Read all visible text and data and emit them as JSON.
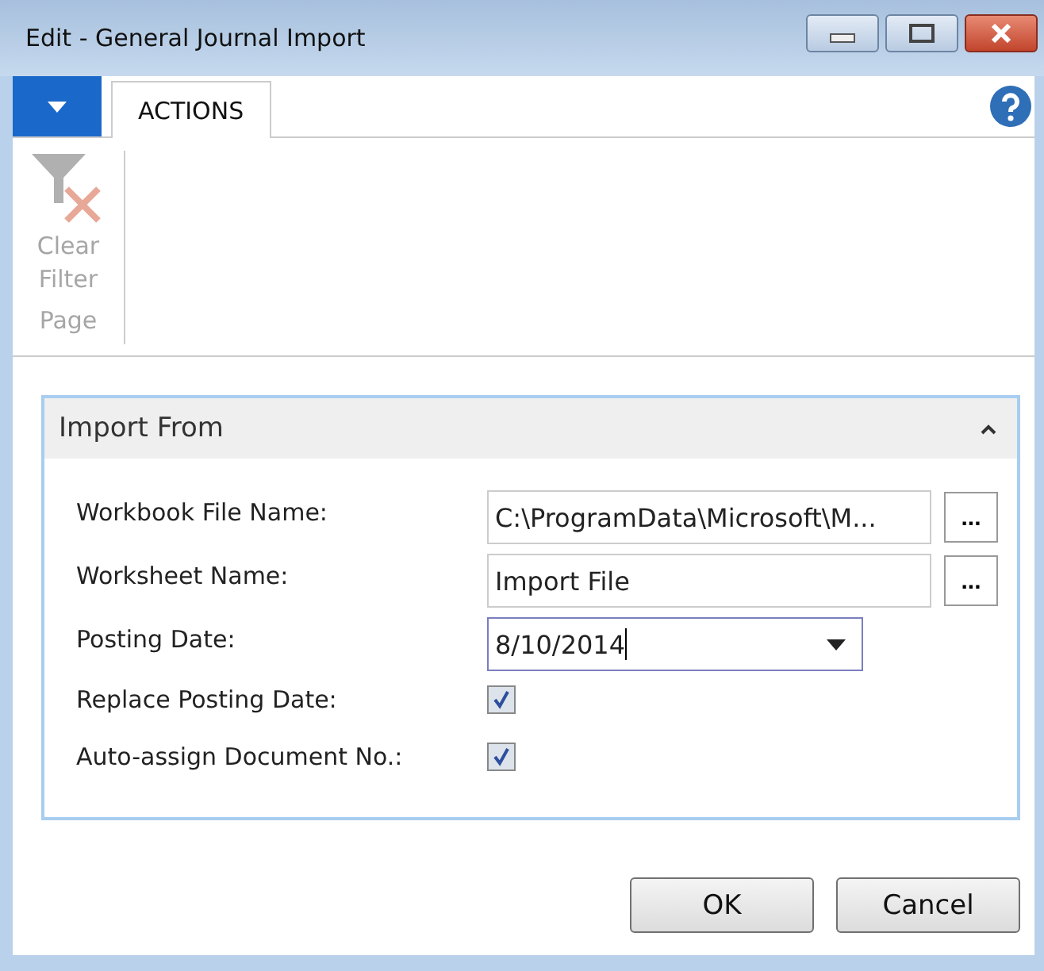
{
  "window": {
    "title": "Edit - General Journal Import"
  },
  "ribbon": {
    "tabs": [
      {
        "label": "ACTIONS",
        "selected": true
      }
    ],
    "actions": [
      {
        "label": "Clear Filter",
        "disabled": true
      }
    ],
    "group": "Page"
  },
  "section": {
    "title": "Import From",
    "expanded": true,
    "fields": [
      {
        "kind": "lookup",
        "label": "Workbook File Name:",
        "value": "C:\\ProgramData\\Microsoft\\M...",
        "button": "..."
      },
      {
        "kind": "lookup",
        "label": "Worksheet Name:",
        "value": "Import File",
        "button": "..."
      },
      {
        "kind": "dropdown",
        "label": "Posting Date:",
        "value": "8/10/2014"
      },
      {
        "kind": "checkbox",
        "label": "Replace Posting Date:",
        "checked": true
      },
      {
        "kind": "checkbox",
        "label": "Auto-assign Document No.:",
        "checked": true
      }
    ]
  },
  "buttons": [
    "OK",
    "Cancel"
  ]
}
